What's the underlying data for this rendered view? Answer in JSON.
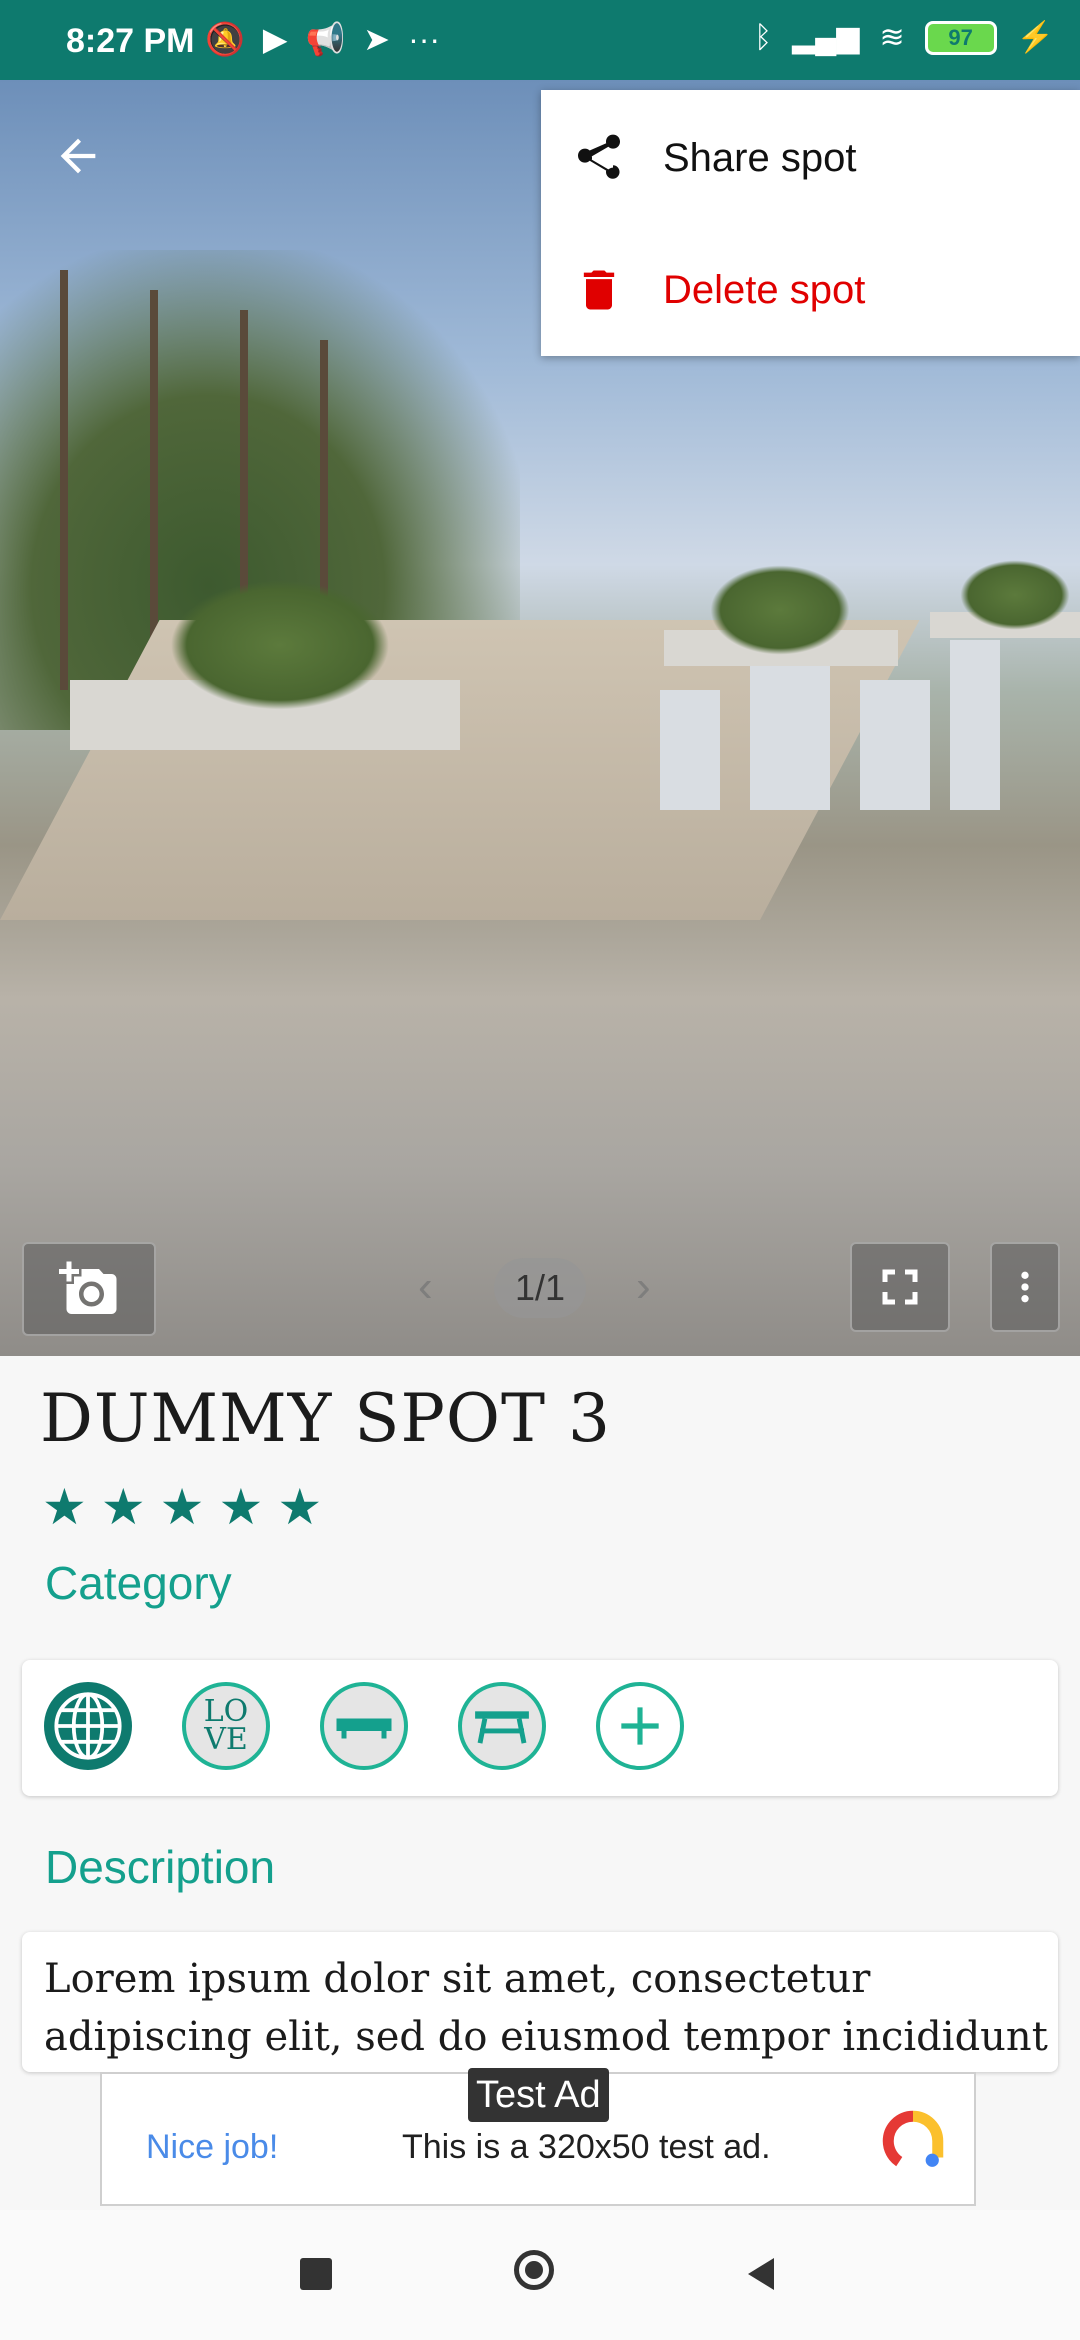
{
  "status_bar": {
    "time": "8:27 PM",
    "battery": "97"
  },
  "menu": {
    "share_label": "Share spot",
    "delete_label": "Delete spot"
  },
  "photo": {
    "pager": "1/1"
  },
  "spot": {
    "title": "DUMMY SPOT 3",
    "rating": 5,
    "category_label": "Category",
    "category_icons": [
      "globe-icon",
      "love-icon",
      "bench-icon",
      "picnic-table-icon",
      "add-icon"
    ],
    "description_label": "Description",
    "description": "Lorem ipsum dolor sit amet, consectetur adipiscing elit, sed do eiusmod tempor incididunt"
  },
  "ad": {
    "badge": "Test Ad",
    "left_text": "Nice job!",
    "body_text": "This is a 320x50 test ad."
  },
  "colors": {
    "accent": "#0e7a6e",
    "accent_light": "#14a08d",
    "danger": "#e00000"
  }
}
